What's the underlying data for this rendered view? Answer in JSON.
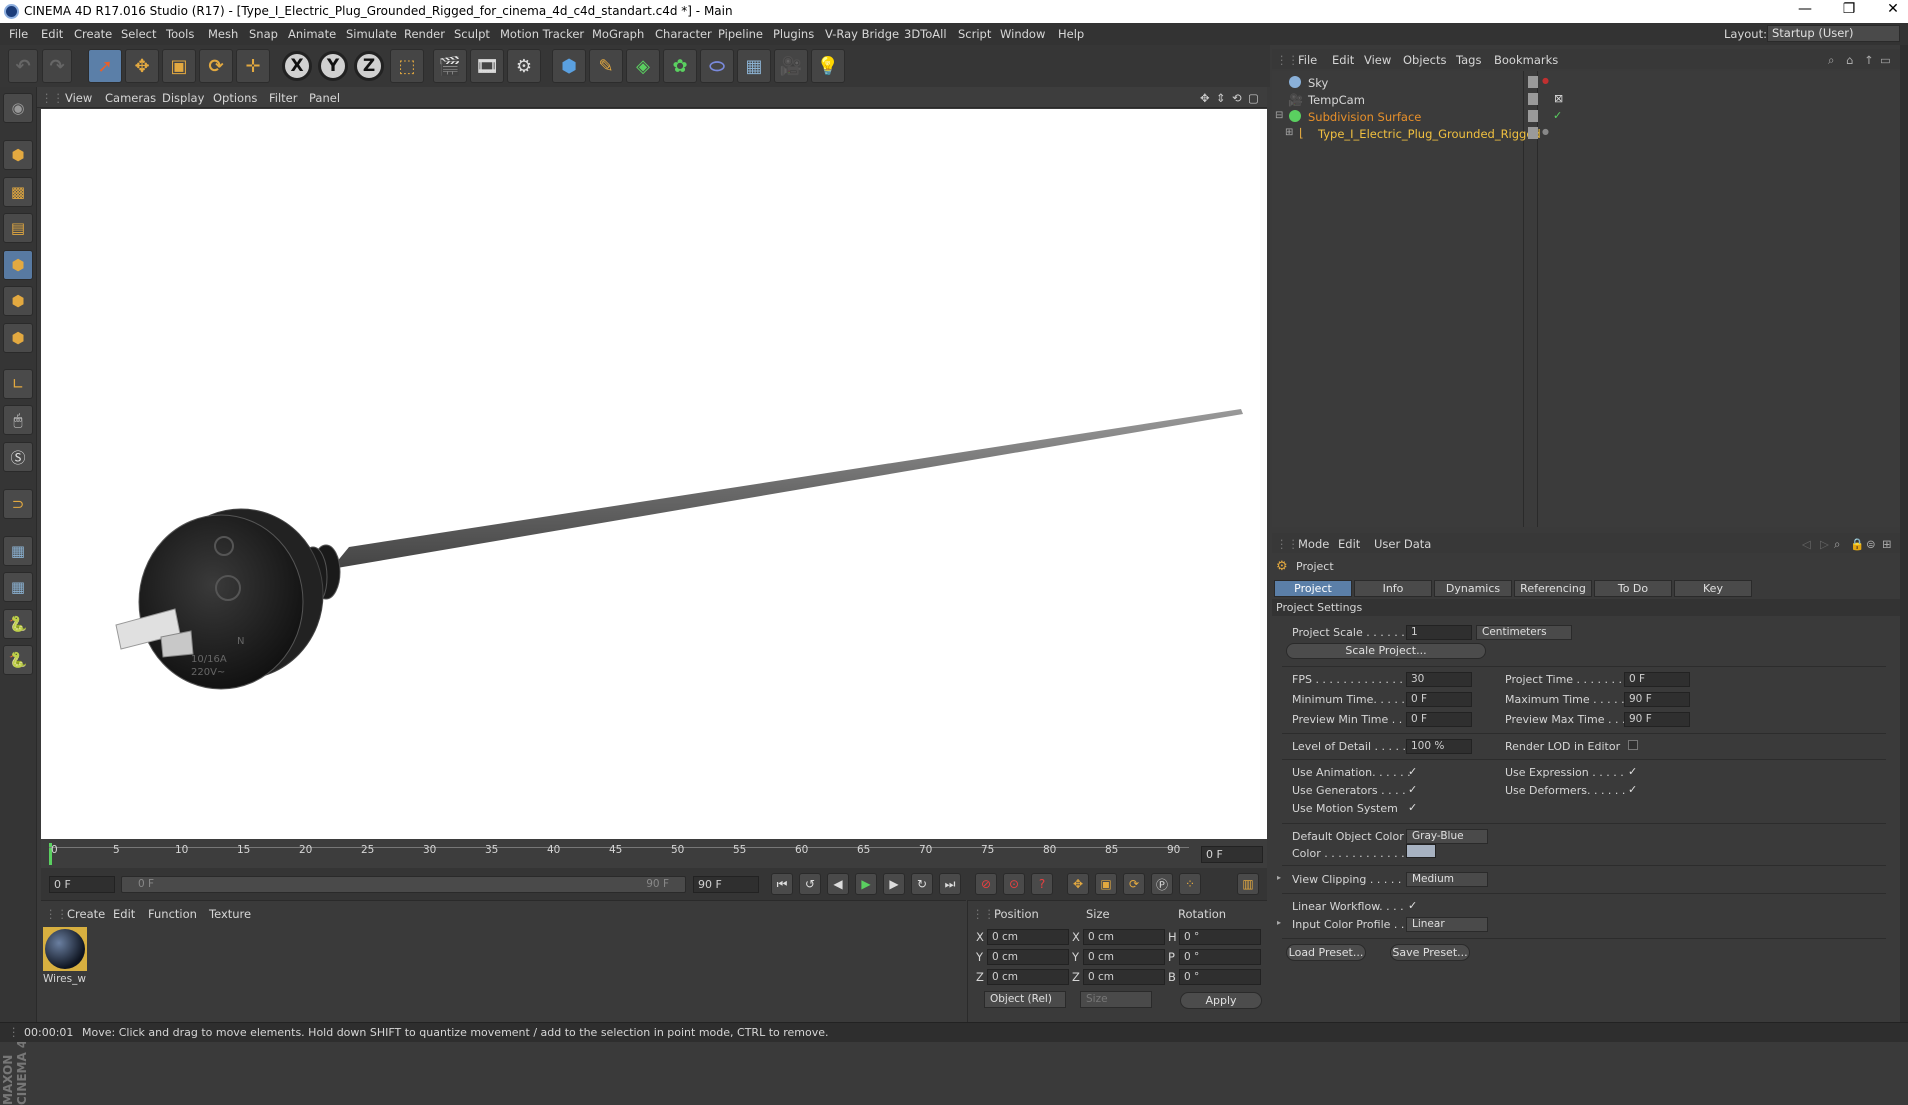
{
  "window": {
    "title": "CINEMA 4D R17.016 Studio (R17) - [Type_I_Electric_Plug_Grounded_Rigged_for_cinema_4d_c4d_standart.c4d *] - Main",
    "minimize": "—",
    "maximize": "❐",
    "close": "✕"
  },
  "menubar": {
    "items": [
      "File",
      "Edit",
      "Create",
      "Select",
      "Tools",
      "Mesh",
      "Snap",
      "Animate",
      "Simulate",
      "Render",
      "Sculpt",
      "Motion Tracker",
      "MoGraph",
      "Character",
      "Pipeline",
      "Plugins",
      "V-Ray Bridge",
      "3DToAll",
      "Script",
      "Window",
      "Help"
    ],
    "layout_label": "Layout:",
    "layout_value": "Startup (User)"
  },
  "toolbar": {
    "axis_x": "X",
    "axis_y": "Y",
    "axis_z": "Z"
  },
  "viewport": {
    "menu": [
      "View",
      "Cameras",
      "Display",
      "Options",
      "Filter",
      "Panel"
    ],
    "plug_marking_1": "10/16A",
    "plug_marking_2": "220V~",
    "plug_marking_n": "N"
  },
  "timeline": {
    "ticks": [
      "0",
      "5",
      "10",
      "15",
      "20",
      "25",
      "30",
      "35",
      "40",
      "45",
      "50",
      "55",
      "60",
      "65",
      "70",
      "75",
      "80",
      "85",
      "90"
    ],
    "current_frame": "0 F"
  },
  "transport": {
    "start_field": "0 F",
    "range_start": "0 F",
    "range_end": "90 F",
    "end_field": "90 F"
  },
  "materials": {
    "menu": [
      "Create",
      "Edit",
      "Function",
      "Texture"
    ],
    "items": [
      {
        "name": "Wires_w"
      }
    ]
  },
  "coordinates": {
    "headers": {
      "position": "Position",
      "size": "Size",
      "rotation": "Rotation"
    },
    "rows": [
      {
        "axis": "X",
        "pos": "0 cm",
        "size_axis": "X",
        "size": "0 cm",
        "rot_axis": "H",
        "rot": "0 °"
      },
      {
        "axis": "Y",
        "pos": "0 cm",
        "size_axis": "Y",
        "size": "0 cm",
        "rot_axis": "P",
        "rot": "0 °"
      },
      {
        "axis": "Z",
        "pos": "0 cm",
        "size_axis": "Z",
        "size": "0 cm",
        "rot_axis": "B",
        "rot": "0 °"
      }
    ],
    "mode": "Object (Rel)",
    "size_mode": "Size",
    "apply": "Apply"
  },
  "status": {
    "time": "00:00:01",
    "message": "Move: Click and drag to move elements. Hold down SHIFT to quantize movement / add to the selection in point mode, CTRL to remove."
  },
  "object_manager": {
    "menu": [
      "File",
      "Edit",
      "View",
      "Objects",
      "Tags",
      "Bookmarks"
    ],
    "objects": [
      {
        "name": "Sky",
        "color": "#d6d6d6"
      },
      {
        "name": "TempCam",
        "color": "#d6d6d6"
      },
      {
        "name": "Subdivision Surface",
        "color": "#e8902a"
      },
      {
        "name": "Type_I_Electric_Plug_Grounded_Rigged",
        "color": "#f0c040"
      }
    ]
  },
  "attributes": {
    "menu": [
      "Mode",
      "Edit",
      "User Data"
    ],
    "title": "Project",
    "tabs": [
      "Project Settings",
      "Info",
      "Dynamics",
      "Referencing",
      "To Do",
      "Key Interpolation"
    ],
    "section": "Project Settings",
    "project_scale_label": "Project Scale . . . . . .",
    "project_scale_value": "1",
    "project_scale_unit": "Centimeters",
    "scale_project_btn": "Scale Project...",
    "fps_label": "FPS . . . . . . . . . . . . . .",
    "fps_value": "30",
    "project_time_label": "Project Time . . . . . . .",
    "project_time_value": "0 F",
    "min_time_label": "Minimum Time. . . . . .",
    "min_time_value": "0 F",
    "max_time_label": "Maximum Time . . . . .",
    "max_time_value": "90 F",
    "prev_min_label": "Preview Min Time . . .",
    "prev_min_value": "0 F",
    "prev_max_label": "Preview Max Time . . .",
    "prev_max_value": "90 F",
    "lod_label": "Level of Detail . . . . .",
    "lod_value": "100 %",
    "render_lod_label": "Render LOD in Editor",
    "use_anim_label": "Use Animation. . . . . .",
    "use_expr_label": "Use Expression . . . . .",
    "use_gen_label": "Use Generators . . . .",
    "use_def_label": "Use Deformers. . . . . .",
    "use_motion_label": "Use Motion System",
    "def_color_label": "Default Object Color",
    "def_color_value": "Gray-Blue",
    "color_label": "Color . . . . . . . . . . . .",
    "color_swatch": "#a7b2c1",
    "view_clip_label": "View Clipping . . . . .",
    "view_clip_value": "Medium",
    "linear_wf_label": "Linear Workflow. . . .",
    "input_profile_label": "Input Color Profile . .",
    "input_profile_value": "Linear",
    "load_preset": "Load Preset...",
    "save_preset": "Save Preset...",
    "check": "✓"
  }
}
